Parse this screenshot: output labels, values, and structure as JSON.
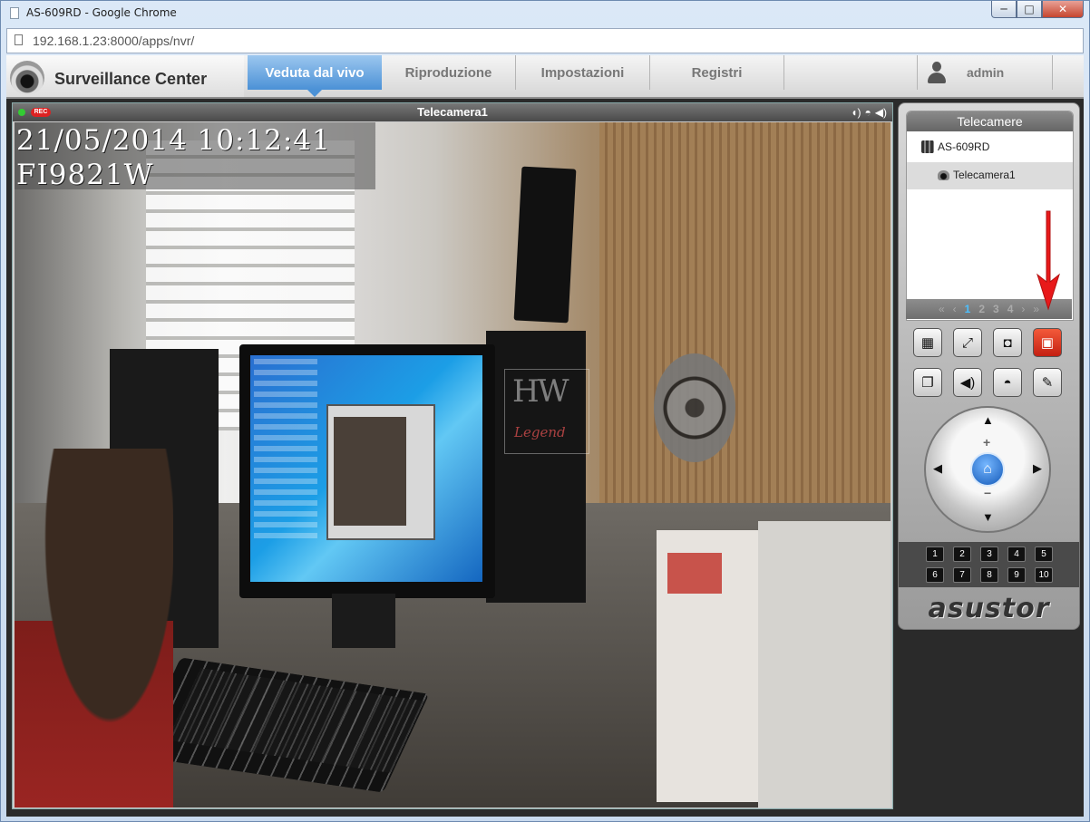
{
  "window": {
    "title": "AS-609RD - Google Chrome",
    "min_label": "─",
    "max_label": "□",
    "close_label": "✕"
  },
  "browser": {
    "url": "192.168.1.23:8000/apps/nvr/"
  },
  "app": {
    "title": "Surveillance Center",
    "tabs": [
      "Veduta dal vivo",
      "Riproduzione",
      "Impostazioni",
      "Registri"
    ],
    "active_tab": "Veduta dal vivo",
    "user": "admin"
  },
  "video": {
    "camera_name": "Telecamera1",
    "rec_label": "REC",
    "osd_datetime": "21/05/2014 10:12:41",
    "osd_model": "FI9821W",
    "watermark_main": "HW",
    "watermark_sub": "Legend",
    "header_icons": [
      "microphone-icon",
      "ptz-camera-icon",
      "speaker-icon"
    ]
  },
  "panel": {
    "tree_title": "Telecamere",
    "nvr_name": "AS-609RD",
    "camera_item": "Telecamera1",
    "pager": {
      "first": "«",
      "prev": "‹",
      "pages": [
        "1",
        "2",
        "3",
        "4"
      ],
      "current": "1",
      "next": "›",
      "last": "»"
    },
    "buttons": [
      {
        "name": "layout-button",
        "icon": "layout-icon",
        "glyph": "▦"
      },
      {
        "name": "fullscreen-button",
        "icon": "fullscreen-icon",
        "glyph": "⤢"
      },
      {
        "name": "snapshot-button",
        "icon": "camera-icon",
        "glyph": "◘"
      },
      {
        "name": "record-button",
        "icon": "record-icon",
        "glyph": "▣"
      },
      {
        "name": "sequence-button",
        "icon": "sequence-icon",
        "glyph": "❐"
      },
      {
        "name": "audio-button",
        "icon": "speaker-icon",
        "glyph": "◀)"
      },
      {
        "name": "ptz-button",
        "icon": "dome-camera-icon",
        "glyph": "◓"
      },
      {
        "name": "settings-button",
        "icon": "wrench-icon",
        "glyph": "✎"
      }
    ],
    "ptz": {
      "up": "▲",
      "down": "▼",
      "left": "◀",
      "right": "▶",
      "home": "⌂",
      "zoom_in": "+",
      "zoom_out": "−"
    },
    "presets": [
      "1",
      "2",
      "3",
      "4",
      "5",
      "6",
      "7",
      "8",
      "9",
      "10"
    ],
    "brand": "asustor"
  },
  "colors": {
    "active_tab": "#4b91d6",
    "record_button": "#d42a18",
    "annotation_arrow": "#e8191a"
  }
}
